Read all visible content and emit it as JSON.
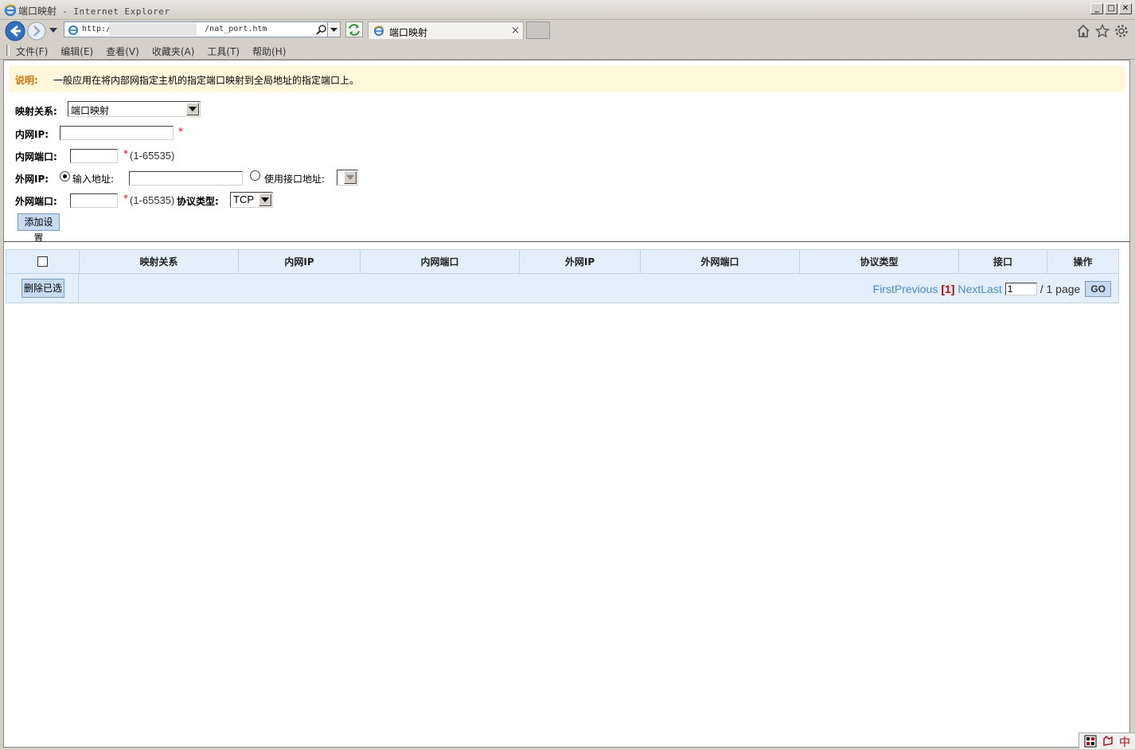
{
  "window": {
    "title": "端口映射",
    "app_name": " - Internet Explorer",
    "buttons": {
      "minimize": "_",
      "maximize": "□",
      "close": "✕"
    }
  },
  "browser": {
    "address_prefix": "http://",
    "address_suffix": "/nat_port.htm",
    "tab_title": "端口映射",
    "tab_close": "×"
  },
  "menu": {
    "items": [
      "文件(F)",
      "编辑(E)",
      "查看(V)",
      "收藏夹(A)",
      "工具(T)",
      "帮助(H)"
    ]
  },
  "note": {
    "label": "说明:",
    "text": "一般应用在将内部网指定主机的指定端口映射到全局地址的指定端口上。"
  },
  "form": {
    "mapping_label": "映射关系:",
    "mapping_value": "端口映射",
    "inner_ip_label": "内网IP:",
    "inner_ip_value": "",
    "required_mark": "*",
    "inner_port_label": "内网端口:",
    "inner_port_value": "",
    "port_range": "(1-65535)",
    "outer_ip_label": "外网IP:",
    "radio_input_addr": "输入地址:",
    "outer_ip_value": "",
    "radio_use_iface": "使用接口地址:",
    "outer_port_label": "外网端口:",
    "outer_port_value": "",
    "protocol_label": "协议类型:",
    "protocol_value": "TCP",
    "add_button": "添加设置"
  },
  "table": {
    "columns": [
      "映射关系",
      "内网IP",
      "内网端口",
      "外网IP",
      "外网端口",
      "协议类型",
      "接口",
      "操作"
    ],
    "rows": [],
    "delete_selected": "删除已选"
  },
  "pager": {
    "first": "First",
    "previous": "Previous",
    "current": "[1]",
    "next": "Next",
    "last": "Last",
    "page_input": "1",
    "total": "/ 1 page",
    "go": "GO"
  },
  "tray": {
    "ime": "中"
  },
  "colors": {
    "note_bg": "#fff8dc",
    "note_label": "#e07000",
    "required": "#e00000",
    "grid_bg": "#e3f0fb",
    "link": "#4a8ad0",
    "current_page": "#d00000"
  }
}
